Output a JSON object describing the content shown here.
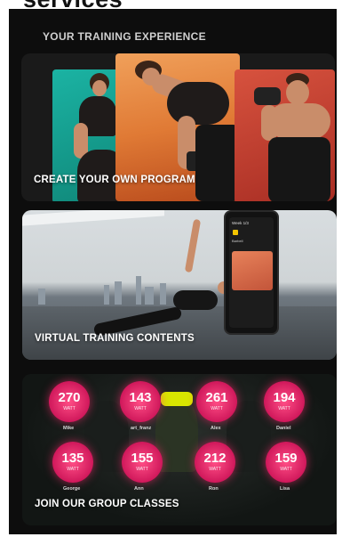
{
  "page": {
    "cut_title": "services",
    "section_title": "YOUR TRAINING EXPERIENCE"
  },
  "cards": [
    {
      "label": "CREATE YOUR OWN PROGRAM"
    },
    {
      "label": "VIRTUAL TRAINING CONTENTS"
    },
    {
      "label": "JOIN OUR GROUP CLASSES"
    }
  ],
  "phone": {
    "screen_title": "Week 1/3",
    "item_label": "Barbell"
  },
  "group_class": {
    "badges": [
      {
        "value": "270",
        "unit": "WATT",
        "name": "Mike"
      },
      {
        "value": "143",
        "unit": "WATT",
        "name": "art_franz"
      },
      {
        "value": "261",
        "unit": "WATT",
        "name": "Alex"
      },
      {
        "value": "194",
        "unit": "WATT",
        "name": "Daniel"
      },
      {
        "value": "135",
        "unit": "WATT",
        "name": "George"
      },
      {
        "value": "155",
        "unit": "WATT",
        "name": "Ann"
      },
      {
        "value": "212",
        "unit": "WATT",
        "name": "Ron"
      },
      {
        "value": "159",
        "unit": "WATT",
        "name": "Lisa"
      }
    ]
  }
}
